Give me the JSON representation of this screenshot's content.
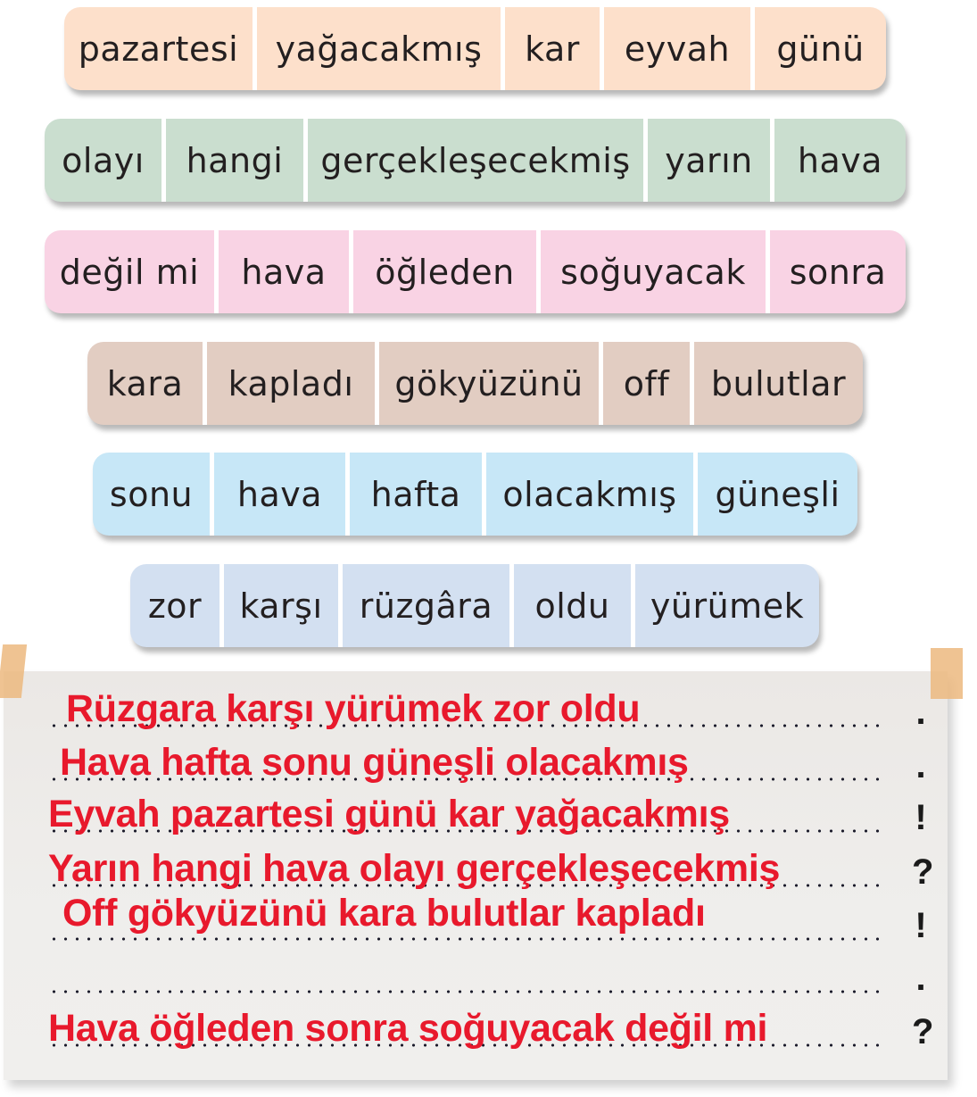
{
  "colors": {
    "row1": "#fde0cb",
    "row2": "#cadecf",
    "row3": "#f9d3e4",
    "row4": "#e2cdc2",
    "row5": "#c7e7f7",
    "row6": "#d3e0f1",
    "answer_text": "#e8192c",
    "paper": "#eeece9",
    "tape": "#ecb97f"
  },
  "word_rows": [
    {
      "words": [
        "pazartesi",
        "yağacakmış",
        "kar",
        "eyvah",
        "günü"
      ]
    },
    {
      "words": [
        "olayı",
        "hangi",
        "gerçekleşecekmiş",
        "yarın",
        "hava"
      ]
    },
    {
      "words": [
        "değil mi",
        "hava",
        "öğleden",
        "soğuyacak",
        "sonra"
      ]
    },
    {
      "words": [
        "kara",
        "kapladı",
        "gökyüzünü",
        "off",
        "bulutlar"
      ]
    },
    {
      "words": [
        "sonu",
        "hava",
        "hafta",
        "olacakmış",
        "güneşli"
      ]
    },
    {
      "words": [
        "zor",
        "karşı",
        "rüzgâra",
        "oldu",
        "yürümek"
      ]
    }
  ],
  "answer_sheet": {
    "lines": [
      {
        "answer": "Rüzgara karşı yürümek zor oldu",
        "punctuation": "."
      },
      {
        "answer": "Hava hafta sonu güneşli olacakmış",
        "punctuation": "."
      },
      {
        "answer": "Eyvah pazartesi günü kar yağacakmış",
        "punctuation": "!"
      },
      {
        "answer": "Yarın hangi hava olayı gerçekleşecekmiş",
        "punctuation": "?"
      },
      {
        "answer": "Off gökyüzünü kara bulutlar kapladı",
        "punctuation": "!"
      },
      {
        "answer": "",
        "punctuation": "."
      },
      {
        "answer": "Hava öğleden sonra soğuyacak değil mi",
        "punctuation": "?"
      }
    ]
  }
}
